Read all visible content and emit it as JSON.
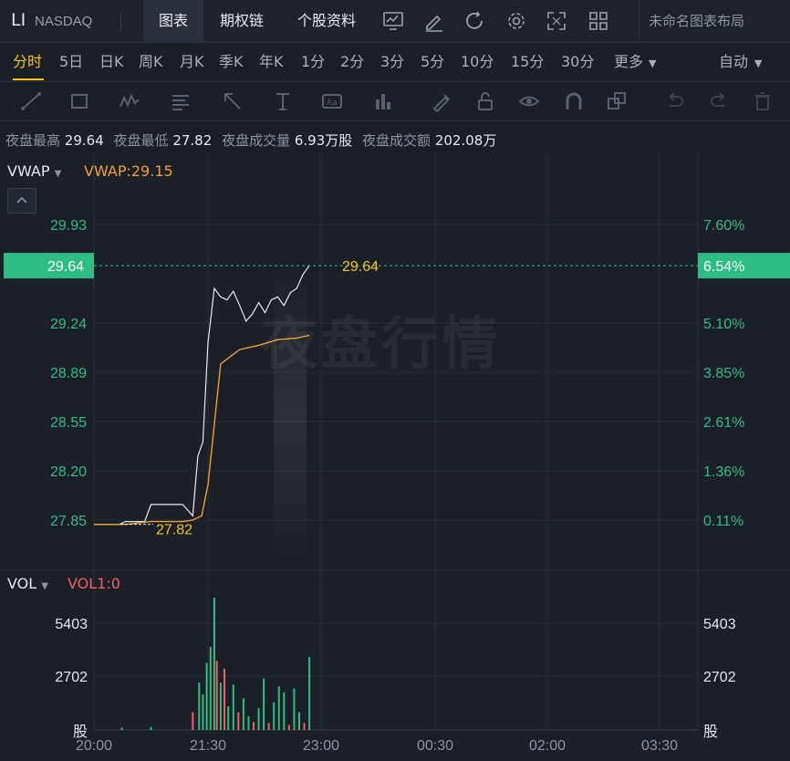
{
  "header": {
    "symbol": "LI",
    "exchange": "NASDAQ",
    "tabs": [
      {
        "label": "图表",
        "active": true
      },
      {
        "label": "期权链",
        "active": false
      },
      {
        "label": "个股资料",
        "active": false
      }
    ],
    "icons": [
      "chart-icon",
      "edit-icon",
      "refresh-icon",
      "gear-icon",
      "fullscreen-icon",
      "grid-layout-icon"
    ],
    "layout_name": "未命名图表布局"
  },
  "periods": {
    "items": [
      "分时",
      "5日",
      "日K",
      "周K",
      "月K",
      "季K",
      "年K",
      "1分",
      "2分",
      "3分",
      "5分",
      "10分",
      "15分",
      "30分",
      "更多"
    ],
    "active": "分时",
    "mode": "自动"
  },
  "drawing_tools": [
    "line-tool-icon",
    "rectangle-tool-icon",
    "pattern-tool-icon",
    "fib-tool-icon",
    "arrow-tool-icon",
    "text-tool-icon",
    "label-tool-icon",
    "volume-profile-icon",
    "brush-icon",
    "lock-icon",
    "eye-icon",
    "magnet-icon",
    "layers-icon",
    "undo-icon",
    "redo-icon",
    "trash-icon"
  ],
  "stats": [
    {
      "label": "夜盘最高",
      "value": "29.64"
    },
    {
      "label": "夜盘最低",
      "value": "27.82"
    },
    {
      "label": "夜盘成交量",
      "value": "6.93万股"
    },
    {
      "label": "夜盘成交额",
      "value": "202.08万"
    }
  ],
  "indicator": {
    "name": "VWAP",
    "value": "VWAP:29.15"
  },
  "volume_indicator": {
    "name": "VOL",
    "value": "VOL1:0"
  },
  "watermark": "夜盘行情",
  "price_marker": {
    "left": "29.64",
    "right": "6.54%"
  },
  "colors": {
    "up": "#2dbd85",
    "down": "#f06060",
    "vwap": "#f0a030",
    "accent": "#f5c518",
    "price_line": "#e6e8ec"
  },
  "chart_data": {
    "type": "line",
    "x_ticks": [
      "20:00",
      "21:30",
      "23:00",
      "00:30",
      "02:00",
      "03:30"
    ],
    "y_ticks_price": [
      "29.93",
      "29.24",
      "28.89",
      "28.55",
      "28.20",
      "27.85"
    ],
    "y_ticks_percent": [
      "7.60%",
      "5.10%",
      "3.85%",
      "2.61%",
      "1.36%",
      "0.11%"
    ],
    "ylim": [
      27.79,
      30.08
    ],
    "high_label": "29.64",
    "low_label": "27.82",
    "series": [
      {
        "name": "VWAP",
        "x_minutes": [
          0,
          25,
          45,
          70,
          78,
          85,
          90,
          100,
          115,
          130,
          145,
          160,
          170
        ],
        "values": [
          27.82,
          27.82,
          27.84,
          27.84,
          27.85,
          27.88,
          28.1,
          28.95,
          29.05,
          29.08,
          29.12,
          29.13,
          29.15
        ]
      },
      {
        "name": "",
        "x_minutes": [
          0,
          20,
          25,
          40,
          45,
          70,
          78,
          82,
          86,
          90,
          95,
          100,
          105,
          110,
          115,
          120,
          125,
          130,
          135,
          140,
          145,
          150,
          155,
          160,
          165,
          170
        ],
        "values": [
          27.82,
          27.82,
          27.84,
          27.84,
          27.96,
          27.96,
          27.88,
          28.3,
          28.4,
          29.1,
          29.48,
          29.42,
          29.4,
          29.46,
          29.36,
          29.25,
          29.3,
          29.38,
          29.31,
          29.4,
          29.42,
          29.36,
          29.45,
          29.48,
          29.58,
          29.64
        ]
      }
    ],
    "volume": {
      "y_ticks": [
        "5403",
        "2702"
      ],
      "unit": "股",
      "bars_x_minutes": [
        22,
        45,
        78,
        83,
        86,
        89,
        92,
        95,
        97,
        100,
        103,
        106,
        110,
        114,
        118,
        122,
        126,
        130,
        134,
        138,
        142,
        146,
        150,
        154,
        158,
        162,
        166,
        170
      ],
      "bars_values": [
        120,
        150,
        900,
        2400,
        1800,
        3400,
        4200,
        6700,
        3500,
        2400,
        3100,
        1200,
        2300,
        900,
        1600,
        700,
        400,
        1100,
        2600,
        350,
        1400,
        2200,
        1900,
        250,
        2100,
        900,
        350,
        3700
      ],
      "bars_up": [
        true,
        true,
        false,
        true,
        true,
        true,
        true,
        true,
        false,
        true,
        false,
        true,
        true,
        false,
        true,
        true,
        false,
        true,
        true,
        false,
        true,
        true,
        true,
        false,
        true,
        true,
        false,
        true
      ]
    }
  }
}
